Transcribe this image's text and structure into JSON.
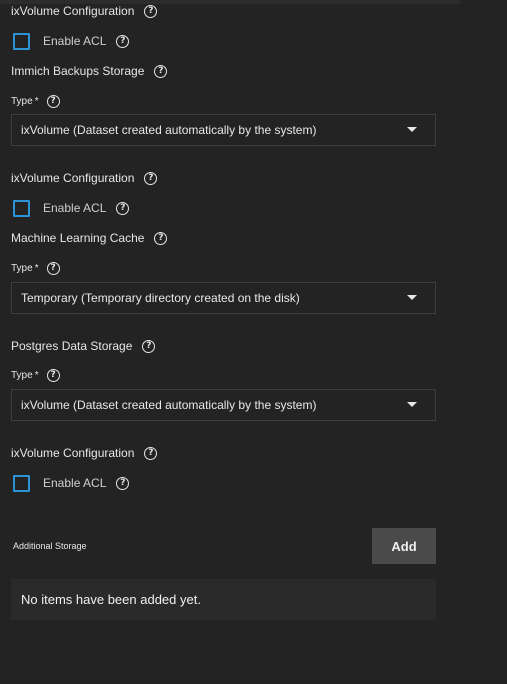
{
  "sections": {
    "ixvolume_config_1": {
      "label": "ixVolume Configuration",
      "acl_label": "Enable ACL"
    },
    "immich_backups": {
      "title": "Immich Backups Storage",
      "type_label": "Type",
      "required_mark": "*",
      "type_value": "ixVolume (Dataset created automatically by the system)"
    },
    "ixvolume_config_2": {
      "label": "ixVolume Configuration",
      "acl_label": "Enable ACL"
    },
    "ml_cache": {
      "title": "Machine Learning Cache",
      "type_label": "Type",
      "required_mark": "*",
      "type_value": "Temporary (Temporary directory created on the disk)"
    },
    "postgres": {
      "title": "Postgres Data Storage",
      "type_label": "Type",
      "required_mark": "*",
      "type_value": "ixVolume (Dataset created automatically by the system)"
    },
    "ixvolume_config_3": {
      "label": "ixVolume Configuration",
      "acl_label": "Enable ACL"
    },
    "additional_storage": {
      "label": "Additional Storage",
      "add_label": "Add",
      "empty_text": "No items have been added yet."
    }
  },
  "icons": {
    "help": "?"
  },
  "colors": {
    "background": "#232323",
    "checkbox_border": "#2b93d6",
    "add_button": "#4a4a4a"
  }
}
